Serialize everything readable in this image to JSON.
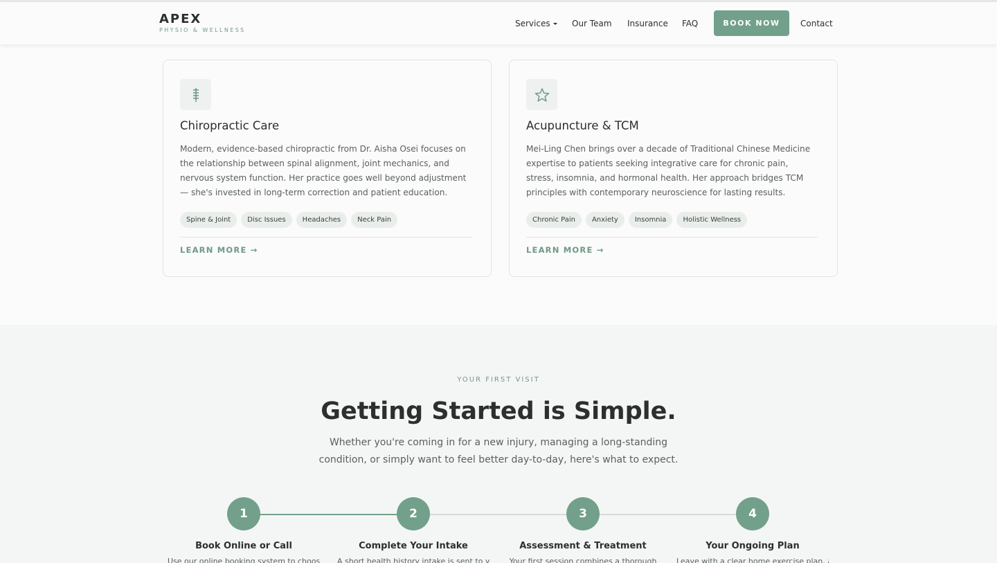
{
  "header": {
    "logo_main": "APEX",
    "logo_sub": "PHYSIO & WELLNESS",
    "nav": {
      "services": "Services",
      "team": "Our Team",
      "insurance": "Insurance",
      "faq": "FAQ",
      "book": "BOOK NOW",
      "contact": "Contact"
    }
  },
  "services": [
    {
      "icon": "spine-icon",
      "title": "Chiropractic Care",
      "description": "Modern, evidence-based chiropractic from Dr. Aisha Osei focuses on the relationship between spinal alignment, joint mechanics, and nervous system function. Her practice goes well beyond adjustment — she's invested in long-term correction and patient education.",
      "tags": [
        "Spine & Joint",
        "Disc Issues",
        "Headaches",
        "Neck Pain"
      ],
      "link": "LEARN MORE →"
    },
    {
      "icon": "star-icon",
      "title": "Acupuncture & TCM",
      "description": "Mei-Ling Chen brings over a decade of Traditional Chinese Medicine expertise to patients seeking integrative care for chronic pain, stress, insomnia, and hormonal health. Her approach bridges TCM principles with contemporary neuroscience for lasting results.",
      "tags": [
        "Chronic Pain",
        "Anxiety",
        "Insomnia",
        "Holistic Wellness"
      ],
      "link": "LEARN MORE →"
    }
  ],
  "first_visit": {
    "eyebrow": "YOUR FIRST VISIT",
    "headline": "Getting Started is Simple.",
    "subtitle": "Whether you're coming in for a new injury, managing a long-standing condition, or simply want to feel better day-to-day, here's what to expect.",
    "steps": [
      {
        "number": "1",
        "title": "Book Online or Call",
        "description": "Use our online booking system to choose"
      },
      {
        "number": "2",
        "title": "Complete Your Intake",
        "description": "A short health history intake is sent to you"
      },
      {
        "number": "3",
        "title": "Assessment & Treatment",
        "description": "Your first session combines a thorough"
      },
      {
        "number": "4",
        "title": "Your Ongoing Plan",
        "description": "Leave with a clear home exercise plan, a"
      }
    ]
  },
  "colors": {
    "accent": "#72a08b",
    "text": "#2b2f2d",
    "muted": "#5a605d",
    "tag_bg": "#eaeeeb"
  }
}
